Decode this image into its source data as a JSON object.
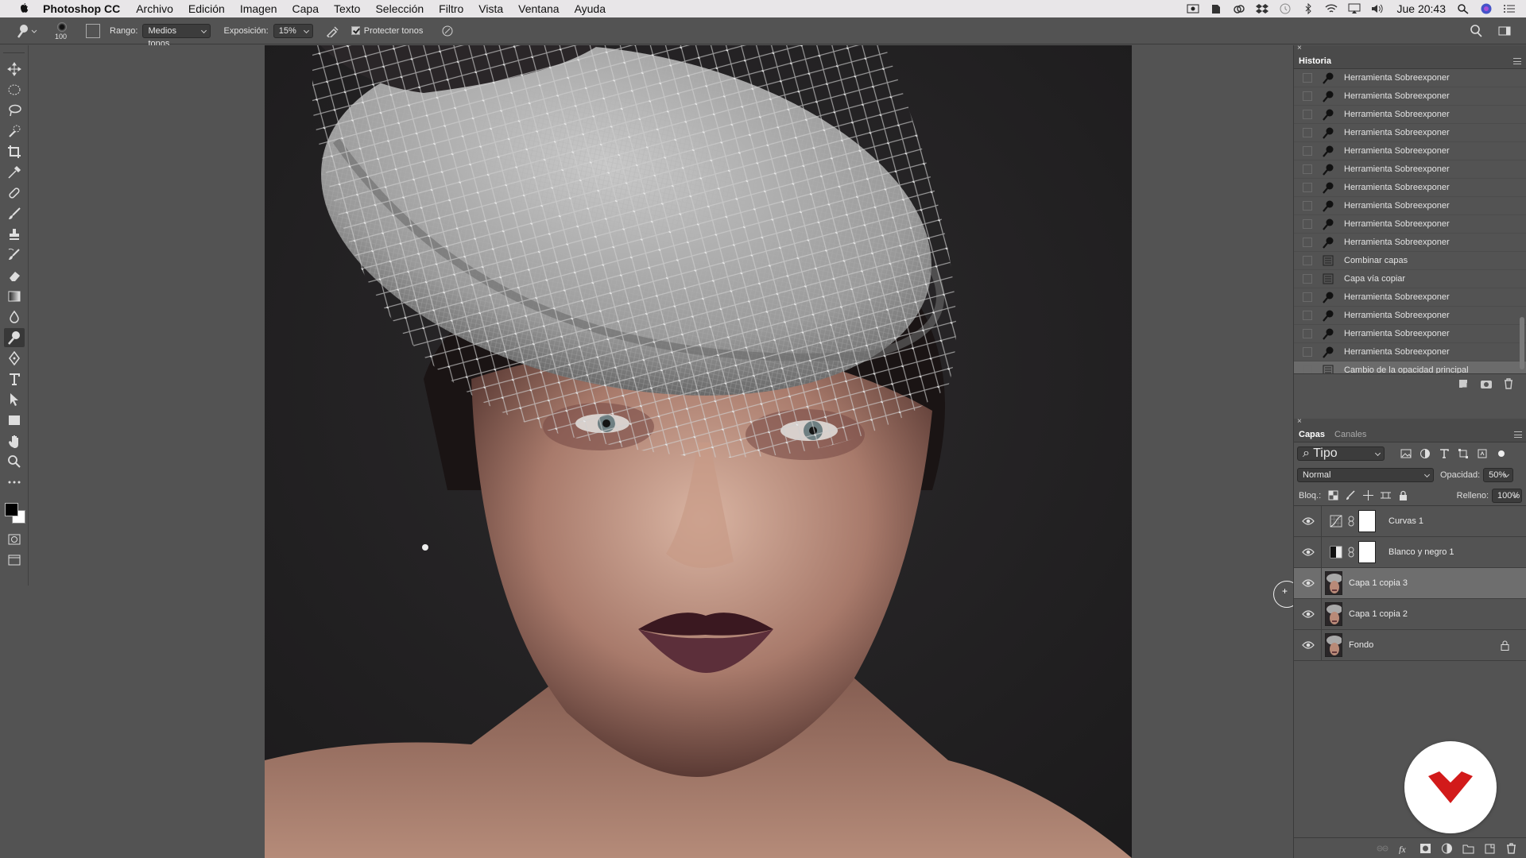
{
  "menubar": {
    "app_name": "Photoshop CC",
    "items": [
      "Archivo",
      "Edición",
      "Imagen",
      "Capa",
      "Texto",
      "Selección",
      "Filtro",
      "Vista",
      "Ventana",
      "Ayuda"
    ],
    "clock": "Jue 20:43"
  },
  "options_bar": {
    "brush_size": "100",
    "range_label": "Rango:",
    "range_value": "Medios tonos",
    "exposure_label": "Exposición:",
    "exposure_value": "15%",
    "protect_tones_label": "Protect​er tonos",
    "protect_tones_checked": true
  },
  "history": {
    "tab": "Historia",
    "items": [
      {
        "label": "Herramienta Sobreexponer",
        "icon": "dodge-icon"
      },
      {
        "label": "Herramienta Sobreexponer",
        "icon": "dodge-icon"
      },
      {
        "label": "Herramienta Sobreexponer",
        "icon": "dodge-icon"
      },
      {
        "label": "Herramienta Sobreexponer",
        "icon": "dodge-icon"
      },
      {
        "label": "Herramienta Sobreexponer",
        "icon": "dodge-icon"
      },
      {
        "label": "Herramienta Sobreexponer",
        "icon": "dodge-icon"
      },
      {
        "label": "Herramienta Sobreexponer",
        "icon": "dodge-icon"
      },
      {
        "label": "Herramienta Sobreexponer",
        "icon": "dodge-icon"
      },
      {
        "label": "Herramienta Sobreexponer",
        "icon": "dodge-icon"
      },
      {
        "label": "Herramienta Sobreexponer",
        "icon": "dodge-icon"
      },
      {
        "label": "Combinar capas",
        "icon": "document-icon"
      },
      {
        "label": "Capa vía copiar",
        "icon": "document-icon"
      },
      {
        "label": "Herramienta Sobreexponer",
        "icon": "dodge-icon"
      },
      {
        "label": "Herramienta Sobreexponer",
        "icon": "dodge-icon"
      },
      {
        "label": "Herramienta Sobreexponer",
        "icon": "dodge-icon"
      },
      {
        "label": "Herramienta Sobreexponer",
        "icon": "dodge-icon"
      },
      {
        "label": "Cambio de la opacidad principal",
        "icon": "document-icon"
      }
    ]
  },
  "layers": {
    "tabs": [
      "Capas",
      "Canales"
    ],
    "filter": "Tipo",
    "blend_mode": "Normal",
    "opacity_label": "Opacidad:",
    "opacity_value": "50%",
    "lock_label": "Bloq.:",
    "fill_label": "Relleno:",
    "fill_value": "100%",
    "items": [
      {
        "name": "Curvas 1",
        "kind": "adjustment",
        "icon": "curves-icon",
        "visible": true
      },
      {
        "name": "Blanco y negro 1",
        "kind": "adjustment",
        "icon": "black-white-icon",
        "visible": true
      },
      {
        "name": "Capa 1 copia 3",
        "kind": "pixel",
        "visible": true,
        "selected": true
      },
      {
        "name": "Capa 1 copia 2",
        "kind": "pixel",
        "visible": true
      },
      {
        "name": "Fondo",
        "kind": "pixel",
        "visible": true,
        "locked": true
      }
    ]
  },
  "colors": {
    "accent_logo": "#d21a1a",
    "selected_row": "#6e6e6e",
    "panel_bg": "#535353"
  }
}
